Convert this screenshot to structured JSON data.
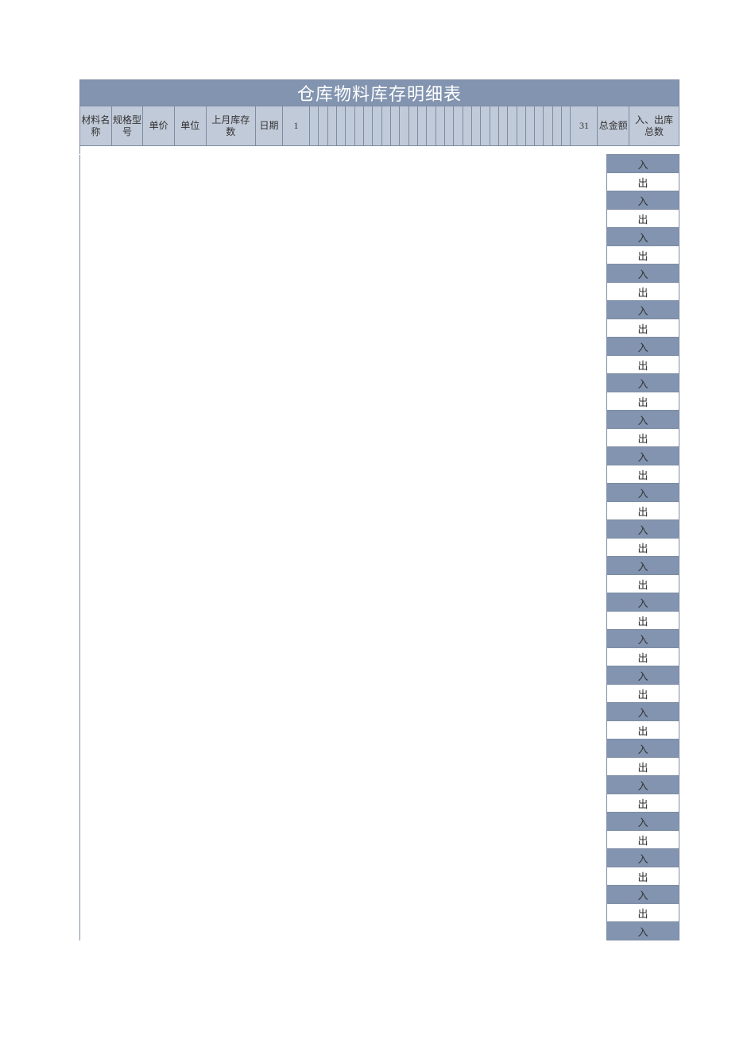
{
  "title": "仓库物料库存明细表",
  "headers": {
    "material_name": "材料名称",
    "spec": "规格型号",
    "unit_price": "单价",
    "unit": "单位",
    "last_month_stock": "上月库存数",
    "date": "日期",
    "day_first": "1",
    "day_last": "31",
    "total_amount": "总金额",
    "in_out_total": "入、出库总数"
  },
  "labels": {
    "in": "入",
    "out": "出"
  },
  "row_count": 22
}
